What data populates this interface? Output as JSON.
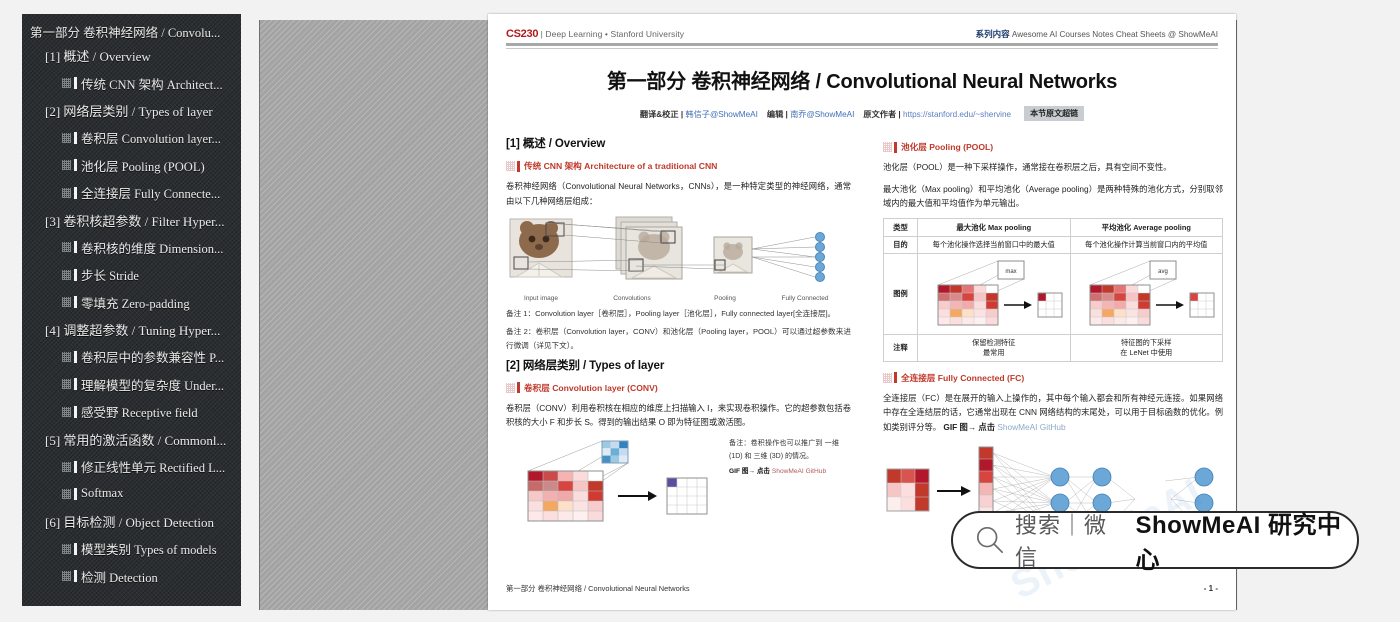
{
  "sidebar": {
    "items": [
      {
        "level": 0,
        "label": "第一部分 卷积神经网络 / Convolu..."
      },
      {
        "level": 1,
        "label": "[1] 概述 / Overview"
      },
      {
        "level": 2,
        "label": "传统 CNN 架构 Architect..."
      },
      {
        "level": 1,
        "label": "[2] 网络层类别 / Types of layer"
      },
      {
        "level": 2,
        "label": "卷积层 Convolution layer..."
      },
      {
        "level": 2,
        "label": "池化层 Pooling (POOL)"
      },
      {
        "level": 2,
        "label": "全连接层 Fully Connecte..."
      },
      {
        "level": 1,
        "label": "[3] 卷积核超参数 / Filter Hyper..."
      },
      {
        "level": 2,
        "label": "卷积核的维度 Dimension..."
      },
      {
        "level": 2,
        "label": "步长 Stride"
      },
      {
        "level": 2,
        "label": "零填充 Zero-padding"
      },
      {
        "level": 1,
        "label": "[4] 调整超参数 / Tuning Hyper..."
      },
      {
        "level": 2,
        "label": "卷积层中的参数兼容性 P..."
      },
      {
        "level": 2,
        "label": "理解模型的复杂度 Under..."
      },
      {
        "level": 2,
        "label": "感受野 Receptive field"
      },
      {
        "level": 1,
        "label": "[5] 常用的激活函数 / Commonl..."
      },
      {
        "level": 2,
        "label": "修正线性单元 Rectified L..."
      },
      {
        "level": 2,
        "label": "Softmax"
      },
      {
        "level": 1,
        "label": "[6] 目标检测 / Object Detection"
      },
      {
        "level": 2,
        "label": "模型类别 Types of models"
      },
      {
        "level": 2,
        "label": "检测 Detection"
      }
    ]
  },
  "page": {
    "header": {
      "course_code": "CS230",
      "course_line": "| Deep Learning • Stanford University",
      "series_cn": "系列内容",
      "series_en": "Awesome AI Courses Notes Cheat Sheets @ ShowMeAI"
    },
    "title_cn": "第一部分 卷积神经网络",
    "title_en": "/ Convolutional Neural Networks",
    "byline": {
      "translate_label": "翻译&校正 |",
      "translator": "韩信子@ShowMeAI",
      "edit_label": "编辑 |",
      "editor": "南乔@ShowMeAI",
      "author_label": "原文作者 |",
      "author_url": "https://stanford.edu/~shervine",
      "chip": "本节原文超链"
    },
    "footer_left": "第一部分 卷积神经网络 / Convolutional Neural Networks",
    "footer_page": "- 1 -",
    "watermark": "ShowMeAI"
  },
  "left_col": {
    "sec1_heading": "[1] 概述 / Overview",
    "sub1_cn": "传统 CNN 架构",
    "sub1_en": "Architecture of a traditional CNN",
    "p1": "卷积神经网络（Convolutional Neural Networks，CNNs），是一种特定类型的神经网络，通常由以下几种网络层组成：",
    "arch_labels": [
      "Input image",
      "Convolutions",
      "Pooling",
      "Fully Connected"
    ],
    "note1": "备注 1：Convolution layer［卷积层］，Pooling layer［池化层］，Fully connected layer[全连接层]。",
    "note2": "备注 2：卷积层（Convolution layer，CONV）和池化层（Pooling layer，POOL）可以通过超参数来进行微调（详见下文）。",
    "sec2_heading": "[2] 网络层类别 / Types of layer",
    "sub2_cn": "卷积层",
    "sub2_en": "Convolution layer (CONV)",
    "p2": "卷积层（CONV）利用卷积核在相应的维度上扫描输入 I，来实现卷积操作。它的超参数包括卷积核的大小 F 和步长 S。得到的输出结果 O 即为特征图或激活图。",
    "conv_note": "备注：卷积操作也可以推广到 一维 (1D) 和 三维 (3D) 的情况。",
    "gif_label": "GIF 图→ 点击",
    "gif_link": "ShowMeAI GitHub"
  },
  "right_col": {
    "sub3_cn": "池化层",
    "sub3_en": "Pooling (POOL)",
    "p3": "池化层（POOL）是一种下采样操作，通常接在卷积层之后，具有空间不变性。",
    "p4": "最大池化（Max pooling）和平均池化（Average pooling）是两种特殊的池化方式，分别取邻域内的最大值和平均值作为单元输出。",
    "pool_table": {
      "row_headers": [
        "类型",
        "目的",
        "图例",
        "注释"
      ],
      "col_headers": [
        "最大池化 Max pooling",
        "平均池化 Average pooling"
      ],
      "purpose": [
        "每个池化操作选择当前窗口中的最大值",
        "每个池化操作计算当前窗口内的平均值"
      ],
      "figure_tags": [
        "max",
        "avg"
      ],
      "remarks": [
        "保留检测特征\n最常用",
        "特征图的下采样\n在 LeNet 中使用"
      ],
      "remarks_max_l1": "保留检测特征",
      "remarks_max_l2": "最常用",
      "remarks_avg_l1": "特征图的下采样",
      "remarks_avg_l2": "在 LeNet 中使用"
    },
    "sub4_cn": "全连接层",
    "sub4_en": "Fully Connected (FC)",
    "p5": "全连接层（FC）是在展开的输入上操作的，其中每个输入都会和所有神经元连接。如果网络中存在全连结层的话，它通常出现在 CNN 网络结构的末尾处，可以用于目标函数的优化。例如类别评分等。",
    "gif_label": "GIF 图→ 点击",
    "gif_link": "ShowMeAI GitHub"
  },
  "search_overlay": {
    "icon": "search-icon",
    "placeholder": "搜索｜微信",
    "brand": "ShowMeAI 研究中心"
  },
  "colors": {
    "accent_red": "#c0392b",
    "brand_dark_red": "#b01b1b",
    "series_blue": "#1f3d6e",
    "sidebar_bg": "#2b2f31",
    "canvas_gray": "#a3a3a3"
  }
}
